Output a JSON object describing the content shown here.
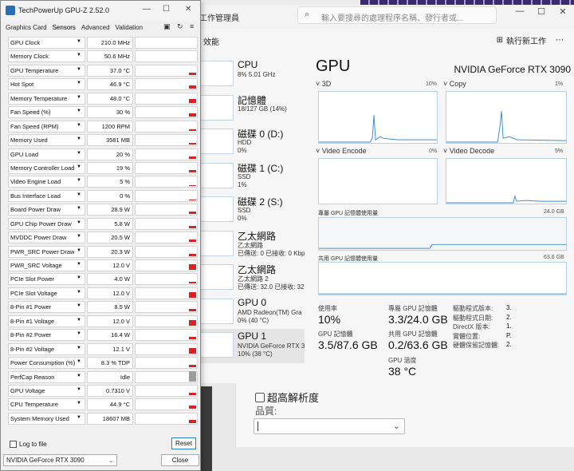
{
  "gpuz": {
    "title": "TechPowerUp GPU-Z 2.52.0",
    "tabs": [
      "Graphics Card",
      "Sensors",
      "Advanced",
      "Validation"
    ],
    "sensors": [
      {
        "name": "GPU Clock",
        "value": "210.0 MHz",
        "level": 0.0
      },
      {
        "name": "Memory Clock",
        "value": "50.6 MHz",
        "level": 0.0
      },
      {
        "name": "GPU Temperature",
        "value": "37.0 °C",
        "level": 0.25
      },
      {
        "name": "Hot Spot",
        "value": "46.9 °C",
        "level": 0.3
      },
      {
        "name": "Memory Temperature",
        "value": "48.0 °C",
        "level": 0.35
      },
      {
        "name": "Fan Speed (%)",
        "value": "30 %",
        "level": 0.3
      },
      {
        "name": "Fan Speed (RPM)",
        "value": "1200 RPM",
        "level": 0.15
      },
      {
        "name": "Memory Used",
        "value": "3581 MB",
        "level": 0.15
      },
      {
        "name": "GPU Load",
        "value": "20 %",
        "level": 0.2
      },
      {
        "name": "Memory Controller Load",
        "value": "19 %",
        "level": 0.2
      },
      {
        "name": "Video Engine Load",
        "value": "5 %",
        "level": 0.1
      },
      {
        "name": "Bus Interface Load",
        "value": "0 %",
        "level": 0.05
      },
      {
        "name": "Board Power Draw",
        "value": "28.9 W",
        "level": 0.25
      },
      {
        "name": "GPU Chip Power Draw",
        "value": "5.8 W",
        "level": 0.2
      },
      {
        "name": "MVDDC Power Draw",
        "value": "20.5 W",
        "level": 0.25
      },
      {
        "name": "PWR_SRC Power Draw",
        "value": "20.3 W",
        "level": 0.25
      },
      {
        "name": "PWR_SRC Voltage",
        "value": "12.0 V",
        "level": 0.55
      },
      {
        "name": "PCIe Slot Power",
        "value": "4.0 W",
        "level": 0.15
      },
      {
        "name": "PCIe Slot Voltage",
        "value": "12.0 V",
        "level": 0.55
      },
      {
        "name": "8-Pin #1 Power",
        "value": "8.5 W",
        "level": 0.2
      },
      {
        "name": "8-Pin #1 Voltage",
        "value": "12.0 V",
        "level": 0.55
      },
      {
        "name": "8-Pin #2 Power",
        "value": "16.4 W",
        "level": 0.25
      },
      {
        "name": "8-Pin #2 Voltage",
        "value": "12.1 V",
        "level": 0.55
      },
      {
        "name": "Power Consumption (%)",
        "value": "8.3 % TDP",
        "level": 0.2
      },
      {
        "name": "PerfCap Reason",
        "value": "Idle",
        "level": 1.0,
        "grey": true
      },
      {
        "name": "GPU Voltage",
        "value": "0.7310 V",
        "level": 0.2
      },
      {
        "name": "CPU Temperature",
        "value": "44.9 °C",
        "level": 0.3
      },
      {
        "name": "System Memory Used",
        "value": "18607 MB",
        "level": 0.3
      }
    ],
    "log_label": "Log to file",
    "reset_label": "Reset",
    "gpu_select": "NVIDIA GeForce RTX 3090",
    "close_label": "Close"
  },
  "taskmgr": {
    "title": "工作管理員",
    "search_placeholder": "輸入要搜尋的處理程序名稱、發行者或...",
    "perf_label": "效能",
    "run_task_label": "執行新工作",
    "devices": [
      {
        "name": "CPU",
        "s1": "8% 5.01 GHz",
        "s2": ""
      },
      {
        "name": "記憶體",
        "s1": "18/127 GB (14%)",
        "s2": ""
      },
      {
        "name": "磁碟 0 (D:)",
        "s1": "HDD",
        "s2": "0%"
      },
      {
        "name": "磁碟 1 (C:)",
        "s1": "SSD",
        "s2": "1%"
      },
      {
        "name": "磁碟 2 (S:)",
        "s1": "SSD",
        "s2": "0%"
      },
      {
        "name": "乙太網路",
        "s1": "乙太網路",
        "s2": "已傳送: 0 已接收: 0 Kbp"
      },
      {
        "name": "乙太網路",
        "s1": "乙太網路 2",
        "s2": "已傳送: 32.0 已接收: 32"
      },
      {
        "name": "GPU 0",
        "s1": "AMD Radeon(TM) Gra",
        "s2": "0% (40 °C)"
      },
      {
        "name": "GPU 1",
        "s1": "NVIDIA GeForce RTX 3",
        "s2": "10% (38 °C)"
      }
    ],
    "gpu_heading": "GPU",
    "gpu_model": "NVIDIA GeForce RTX 3090",
    "engines": [
      {
        "label": "3D",
        "pct": "10%"
      },
      {
        "label": "Copy",
        "pct": "1%"
      },
      {
        "label": "Video Encode",
        "pct": "0%"
      },
      {
        "label": "Video Decode",
        "pct": "5%"
      }
    ],
    "dedicated_label": "專屬 GPU 記憶體使用量",
    "dedicated_max": "24.0 GB",
    "shared_label": "共用 GPU 記憶體使用量",
    "shared_max": "63.6 GB",
    "stats": {
      "util_label": "使用率",
      "util_value": "10%",
      "ded_label": "專屬 GPU 記憶體",
      "ded_value": "3.3/24.0 GB",
      "gpumem_label": "GPU 記憶體",
      "gpumem_value": "3.5/87.6 GB",
      "shared_label": "共用 GPU 記憶體",
      "shared_value": "0.2/63.6 GB",
      "temp_label": "GPU 溫度",
      "temp_value": "38 °C"
    },
    "info": [
      {
        "label": "驅動程式版本:",
        "value": "3."
      },
      {
        "label": "驅動程式日期:",
        "value": "2."
      },
      {
        "label": "DirectX 版本:",
        "value": "1."
      },
      {
        "label": "實體位置:",
        "value": "P."
      },
      {
        "label": "硬體保留記憶體:",
        "value": "2."
      }
    ]
  },
  "bg_app": {
    "hd_label": "超高解析度",
    "quality_label": "品質:"
  }
}
